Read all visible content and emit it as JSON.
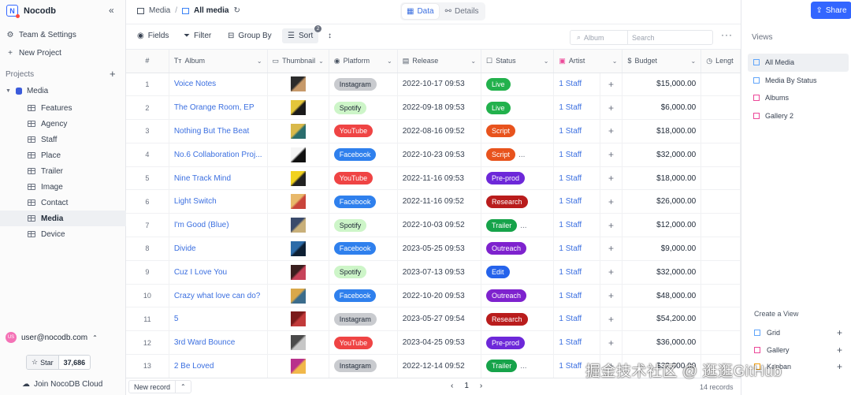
{
  "app": {
    "name": "Nocodb",
    "collapse_icon": "«"
  },
  "sidebar": {
    "team_settings": "Team & Settings",
    "new_project": "New Project",
    "projects_heading": "Projects",
    "project_name": "Media",
    "tables": [
      {
        "label": "Features"
      },
      {
        "label": "Agency"
      },
      {
        "label": "Staff"
      },
      {
        "label": "Place"
      },
      {
        "label": "Trailer"
      },
      {
        "label": "Image"
      },
      {
        "label": "Contact"
      },
      {
        "label": "Media",
        "active": true
      },
      {
        "label": "Device"
      }
    ],
    "user_email": "user@nocodb.com",
    "user_initials": "US",
    "star_label": "Star",
    "star_count": "37,686",
    "join_cloud": "Join NocoDB Cloud"
  },
  "breadcrumb": {
    "table": "Media",
    "separator": "/",
    "view": "All media"
  },
  "view_toggle": {
    "data": "Data",
    "details": "Details"
  },
  "toolbar": {
    "fields": "Fields",
    "filter": "Filter",
    "group_by": "Group By",
    "sort": "Sort",
    "sort_count": "2",
    "search_field": "Album",
    "search_placeholder": "Search"
  },
  "columns": {
    "num": "#",
    "album": "Album",
    "thumbnail": "Thumbnail",
    "platform": "Platform",
    "release": "Release",
    "status": "Status",
    "artist": "Artist",
    "budget": "Budget",
    "length": "Lengt"
  },
  "platform_colors": {
    "Instagram": {
      "bg": "#c9cbcf",
      "fg": "#1f2937"
    },
    "Spotify": {
      "bg": "#cdf5c8",
      "fg": "#1f2937"
    },
    "YouTube": {
      "bg": "#ef4444",
      "fg": "#ffffff"
    },
    "Facebook": {
      "bg": "#2f80ed",
      "fg": "#ffffff"
    }
  },
  "status_colors": {
    "Live": {
      "bg": "#22b14c",
      "fg": "#ffffff"
    },
    "Script": {
      "bg": "#e8531d",
      "fg": "#ffffff"
    },
    "Pre-prod": {
      "bg": "#6d28d9",
      "fg": "#ffffff"
    },
    "Research": {
      "bg": "#b91c1c",
      "fg": "#ffffff"
    },
    "Trailer": {
      "bg": "#16a34a",
      "fg": "#ffffff"
    },
    "Outreach": {
      "bg": "#7e22ce",
      "fg": "#ffffff"
    },
    "Edit": {
      "bg": "#2563eb",
      "fg": "#ffffff"
    }
  },
  "rows": [
    {
      "num": "1",
      "album": "Voice Notes",
      "thumb": [
        "#2b2b2b",
        "#c79a6a"
      ],
      "platform": "Instagram",
      "release": "2022-10-17 09:53",
      "status": "Live",
      "extra": "",
      "artist": "1 Staff",
      "plus": "+",
      "budget": "$15,000.00"
    },
    {
      "num": "2",
      "album": "The Orange Room, EP",
      "thumb": [
        "#e3c63a",
        "#1a1a1a"
      ],
      "platform": "Spotify",
      "release": "2022-09-18 09:53",
      "status": "Live",
      "extra": "",
      "artist": "1 Staff",
      "plus": "+",
      "budget": "$6,000.00"
    },
    {
      "num": "3",
      "album": "Nothing But The Beat",
      "thumb": [
        "#d9b94a",
        "#2a6d6d"
      ],
      "platform": "YouTube",
      "release": "2022-08-16 09:52",
      "status": "Script",
      "extra": "",
      "artist": "1 Staff",
      "plus": "+",
      "budget": "$18,000.00"
    },
    {
      "num": "4",
      "album": "No.6 Collaboration Proj...",
      "thumb": [
        "#f5f5f5",
        "#111111"
      ],
      "platform": "Facebook",
      "release": "2022-10-23 09:53",
      "status": "Script",
      "extra": "...",
      "artist": "1 Staff",
      "plus": "+",
      "budget": "$32,000.00"
    },
    {
      "num": "5",
      "album": "Nine Track Mind",
      "thumb": [
        "#f1d21f",
        "#222222"
      ],
      "platform": "YouTube",
      "release": "2022-11-16 09:53",
      "status": "Pre-prod",
      "extra": "",
      "artist": "1 Staff",
      "plus": "+",
      "budget": "$18,000.00"
    },
    {
      "num": "6",
      "album": "Light Switch",
      "thumb": [
        "#e8b86a",
        "#c9443b"
      ],
      "platform": "Facebook",
      "release": "2022-11-16 09:52",
      "status": "Research",
      "extra": "",
      "artist": "1 Staff",
      "plus": "+",
      "budget": "$26,000.00"
    },
    {
      "num": "7",
      "album": "I'm Good (Blue)",
      "thumb": [
        "#3a4a6b",
        "#c9b07a"
      ],
      "platform": "Spotify",
      "release": "2022-10-03 09:52",
      "status": "Trailer",
      "extra": "...",
      "artist": "1 Staff",
      "plus": "+",
      "budget": "$12,000.00"
    },
    {
      "num": "8",
      "album": "Divide",
      "thumb": [
        "#2c6ba8",
        "#0d1f33"
      ],
      "platform": "Facebook",
      "release": "2023-05-25 09:53",
      "status": "Outreach",
      "extra": "",
      "artist": "1 Staff",
      "plus": "+",
      "budget": "$9,000.00"
    },
    {
      "num": "9",
      "album": "Cuz I Love You",
      "thumb": [
        "#3a1f1f",
        "#c7435a"
      ],
      "platform": "Spotify",
      "release": "2023-07-13 09:53",
      "status": "Edit",
      "extra": "",
      "artist": "1 Staff",
      "plus": "+",
      "budget": "$32,000.00"
    },
    {
      "num": "10",
      "album": "Crazy what love can do?",
      "thumb": [
        "#d9a84a",
        "#3b6c8c"
      ],
      "platform": "Facebook",
      "release": "2022-10-20 09:53",
      "status": "Outreach",
      "extra": "",
      "artist": "1 Staff",
      "plus": "+",
      "budget": "$48,000.00"
    },
    {
      "num": "11",
      "album": "5",
      "thumb": [
        "#7a1a1a",
        "#c23a3a"
      ],
      "platform": "Instagram",
      "release": "2023-05-27 09:54",
      "status": "Research",
      "extra": "",
      "artist": "1 Staff",
      "plus": "+",
      "budget": "$54,200.00"
    },
    {
      "num": "12",
      "album": "3rd Ward Bounce",
      "thumb": [
        "#4a4a4a",
        "#c7c7c7"
      ],
      "platform": "YouTube",
      "release": "2023-04-25 09:53",
      "status": "Pre-prod",
      "extra": "",
      "artist": "1 Staff",
      "plus": "+",
      "budget": "$36,000.00"
    },
    {
      "num": "13",
      "album": "2 Be Loved",
      "thumb": [
        "#b8328c",
        "#f1b84a"
      ],
      "platform": "Instagram",
      "release": "2022-12-14 09:52",
      "status": "Trailer",
      "extra": "...",
      "artist": "1 Staff",
      "plus": "+",
      "budget": "$32,000.00"
    }
  ],
  "footer": {
    "new_record": "New record",
    "page": "1",
    "prev": "‹",
    "next": "›",
    "count": "14 records"
  },
  "right_panel": {
    "share": "Share",
    "views_heading": "Views",
    "views": [
      {
        "label": "All Media",
        "kind": "grid",
        "active": true
      },
      {
        "label": "Media By Status",
        "kind": "grid"
      },
      {
        "label": "Albums",
        "kind": "gallery"
      },
      {
        "label": "Gallery 2",
        "kind": "gallery"
      }
    ],
    "create_heading": "Create a View",
    "create_options": [
      {
        "label": "Grid"
      },
      {
        "label": "Gallery"
      },
      {
        "label": "Kanban"
      }
    ]
  },
  "watermark": "掘金技术社区 @ 逛逛GitHub",
  "colors": {
    "accent": "#3366ff",
    "link": "#3b6fe0"
  }
}
